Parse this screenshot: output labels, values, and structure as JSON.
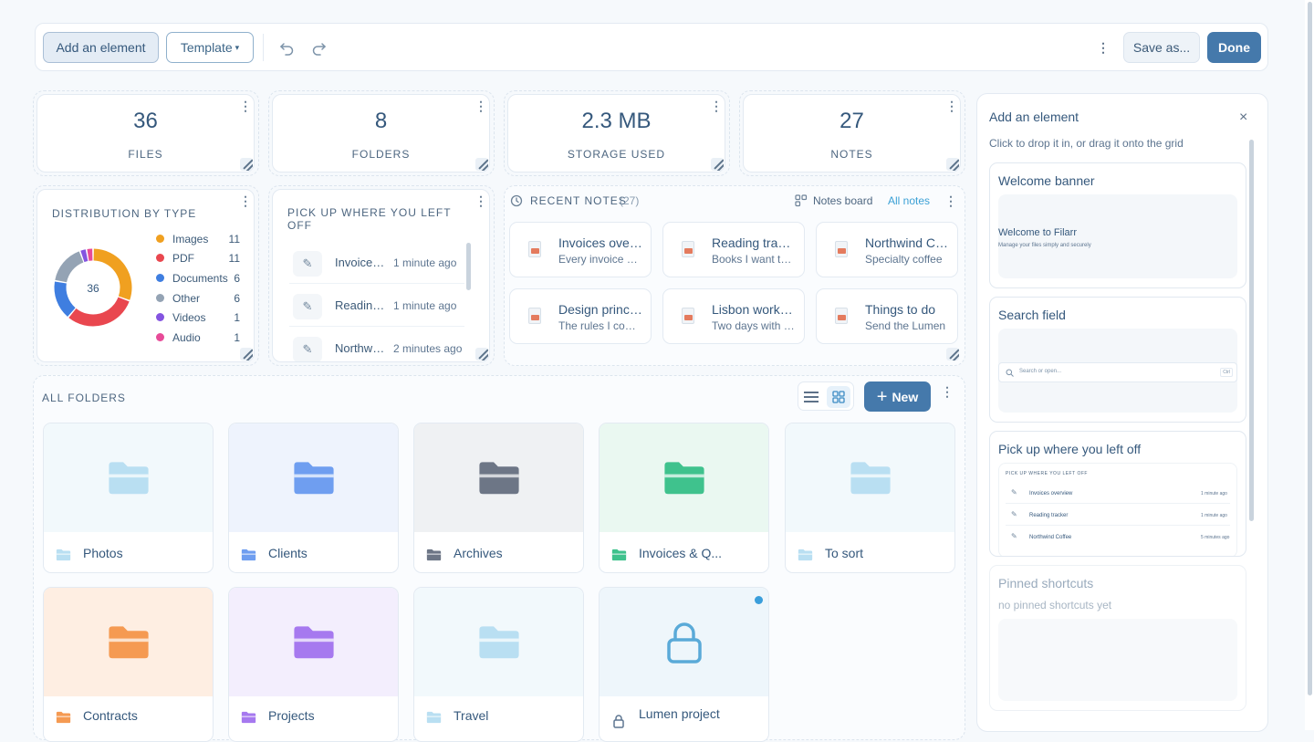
{
  "toolbar": {
    "add_element_label": "Add an element",
    "template_label": "Template",
    "template_caret": "▾",
    "save_as_label": "Save as...",
    "done_label": "Done"
  },
  "stats": [
    {
      "value": "36",
      "label": "FILES"
    },
    {
      "value": "8",
      "label": "FOLDERS"
    },
    {
      "value": "2.3 MB",
      "label": "STORAGE USED"
    },
    {
      "value": "27",
      "label": "NOTES"
    }
  ],
  "distribution": {
    "title": "DISTRIBUTION BY TYPE",
    "total": "36",
    "items": [
      {
        "label": "Images",
        "count": 11,
        "color": "#f0a020"
      },
      {
        "label": "PDF",
        "count": 11,
        "color": "#e9474f"
      },
      {
        "label": "Documents",
        "count": 6,
        "color": "#3f7ee0"
      },
      {
        "label": "Other",
        "count": 6,
        "color": "#94a3b4"
      },
      {
        "label": "Videos",
        "count": 1,
        "color": "#8454e0"
      },
      {
        "label": "Audio",
        "count": 1,
        "color": "#e74b98"
      }
    ]
  },
  "pickup": {
    "title": "PICK UP WHERE YOU LEFT OFF",
    "items": [
      {
        "name": "Invoices overview",
        "time": "1 minute ago"
      },
      {
        "name": "Reading tracker",
        "time": "1 minute ago"
      },
      {
        "name": "Northwind Coffee",
        "time": "2 minutes ago"
      }
    ]
  },
  "recent_notes": {
    "title": "RECENT NOTES",
    "count": "(27)",
    "board_label": "Notes board",
    "all_label": "All notes",
    "notes": [
      {
        "title": "Invoices overview",
        "snippet": "Every invoice and"
      },
      {
        "title": "Reading tracker",
        "snippet": "Books I want to read"
      },
      {
        "title": "Northwind Coffee",
        "snippet": "Specialty coffee"
      },
      {
        "title": "Design principles",
        "snippet": "The rules I come back"
      },
      {
        "title": "Lisbon workshop",
        "snippet": "Two days with the team"
      },
      {
        "title": "Things to do",
        "snippet": "Send the Lumen"
      }
    ]
  },
  "folders": {
    "title": "ALL FOLDERS",
    "new_label": "New",
    "items": [
      {
        "name": "Photos",
        "color": "#b9dff2",
        "bg": "#f2f9fc"
      },
      {
        "name": "Clients",
        "color": "#6f9ef0",
        "bg": "#eef3fd"
      },
      {
        "name": "Archives",
        "color": "#6d7686",
        "bg": "#eff1f3"
      },
      {
        "name": "Invoices & Q...",
        "color": "#3fc28d",
        "bg": "#eaf8f1"
      },
      {
        "name": "To sort",
        "color": "#b9dff2",
        "bg": "#f2f9fc"
      },
      {
        "name": "Contracts",
        "color": "#f59a52",
        "bg": "#feeee2"
      },
      {
        "name": "Projects",
        "color": "#a679ef",
        "bg": "#f3eefd"
      },
      {
        "name": "Travel",
        "color": "#b9dff2",
        "bg": "#f2f9fc"
      },
      {
        "name": "Lumen project",
        "color": "#5aaad8",
        "bg": "#eef6fb"
      }
    ]
  },
  "panel": {
    "title": "Add an element",
    "subtitle": "Click to drop it in, or drag it onto the grid",
    "welcome": {
      "title": "Welcome banner",
      "preview_title": "Welcome to Filarr",
      "preview_sub": "Manage your files simply and securely"
    },
    "search": {
      "title": "Search field",
      "placeholder": "Search or open...",
      "shortcut": "Ctrl"
    },
    "pickup": {
      "title": "Pick up where you left off",
      "preview_title": "PICK UP WHERE YOU LEFT OFF",
      "items": [
        {
          "name": "Invoices overview",
          "time": "1 minute ago"
        },
        {
          "name": "Reading tracker",
          "time": "1 minute ago"
        },
        {
          "name": "Northwind Coffee",
          "time": "5 minutes ago"
        }
      ]
    },
    "pinned": {
      "title": "Pinned shortcuts",
      "empty": "no pinned shortcuts yet"
    }
  },
  "icons": {
    "undo": "undo-icon",
    "redo": "redo-icon",
    "kebab": "more-vert-icon",
    "resize": "resize-handle-icon",
    "clock": "clock-icon",
    "pencil": "pencil-icon",
    "note": "note-icon",
    "folder": "folder-icon",
    "lock": "lock-icon",
    "list": "list-view-icon",
    "grid": "grid-view-icon",
    "plus": "plus-icon",
    "close": "close-icon"
  }
}
